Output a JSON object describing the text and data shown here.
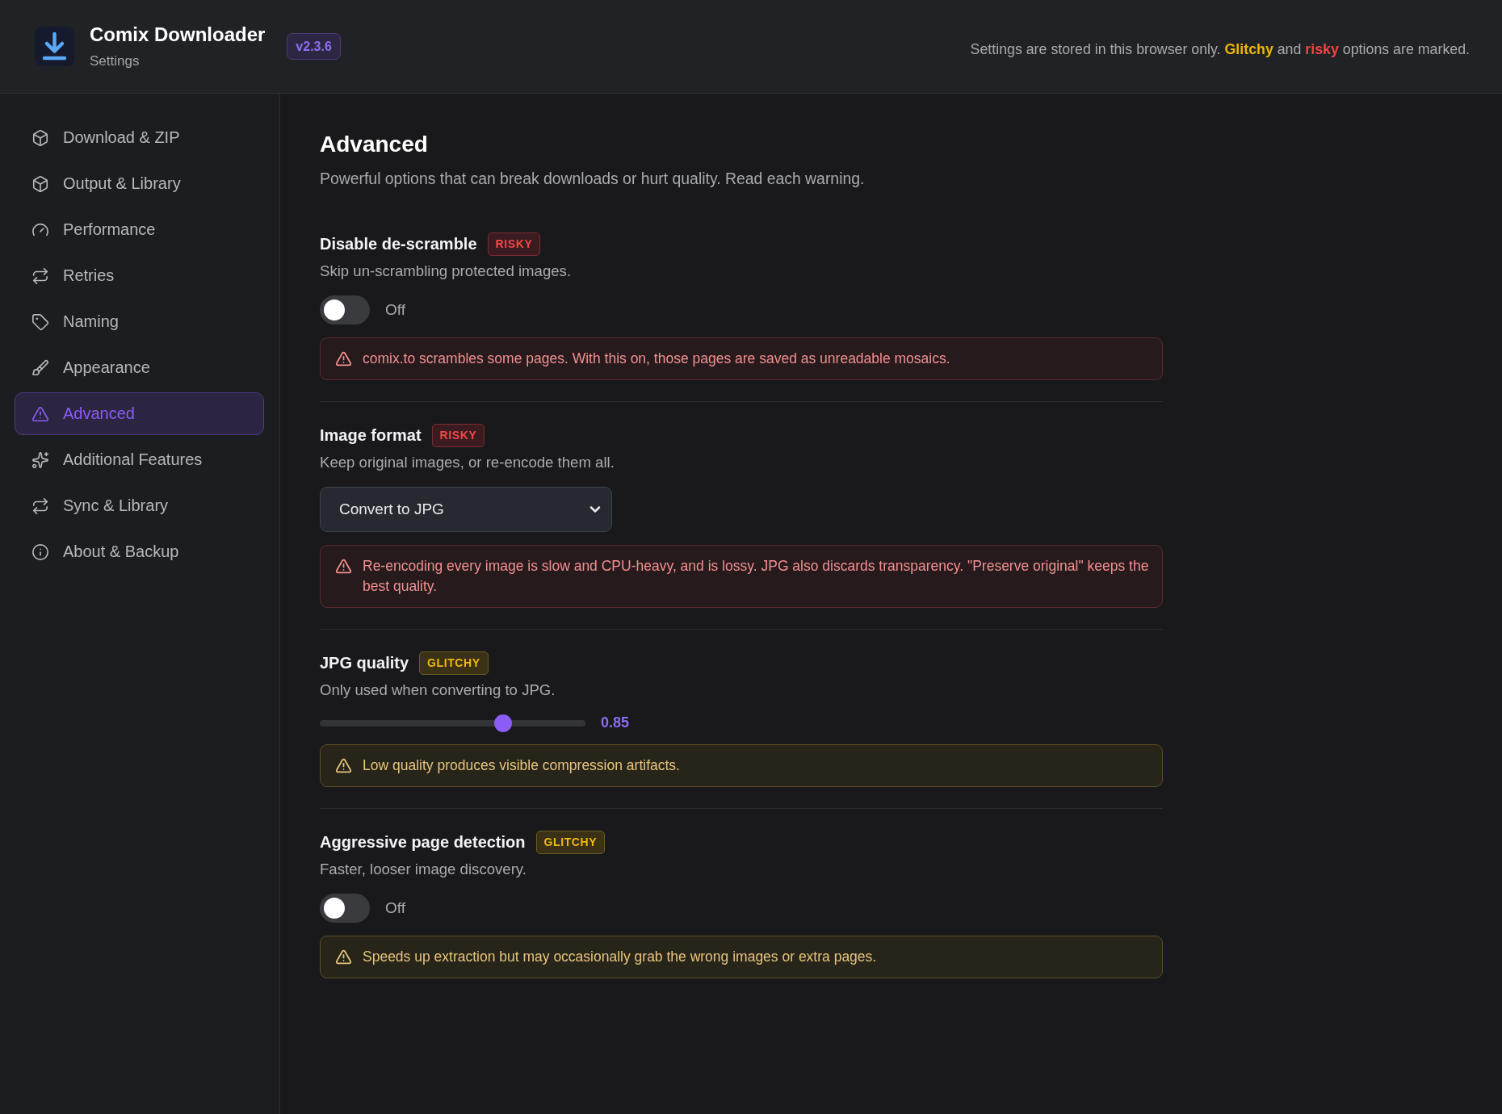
{
  "header": {
    "title": "Comix Downloader",
    "subtitle": "Settings",
    "version": "v2.3.6",
    "notice": [
      {
        "text": "Settings are stored in this browser only.",
        "kind": "plain"
      },
      {
        "text": "Glitchy",
        "kind": "glitchy"
      },
      {
        "text": "and",
        "kind": "plain"
      },
      {
        "text": "risky",
        "kind": "risky"
      },
      {
        "text": "options are marked.",
        "kind": "plain"
      }
    ]
  },
  "sidebar": {
    "items": [
      {
        "label": "Download & ZIP",
        "selected": false
      },
      {
        "label": "Output & Library",
        "selected": false
      },
      {
        "label": "Performance",
        "selected": false
      },
      {
        "label": "Retries",
        "selected": false
      },
      {
        "label": "Naming",
        "selected": false
      },
      {
        "label": "Appearance",
        "selected": false
      },
      {
        "label": "Advanced",
        "selected": true
      },
      {
        "label": "Additional Features",
        "selected": false
      },
      {
        "label": "Sync & Library",
        "selected": false
      },
      {
        "label": "About & Backup",
        "selected": false
      }
    ]
  },
  "page": {
    "title": "Advanced",
    "description": "Powerful options that can break downloads or hurt quality. Read each warning."
  },
  "settings": [
    {
      "kind": "toggle",
      "label": "Disable de-scramble",
      "badge": {
        "text": "RISKY",
        "kind": "risky"
      },
      "description": "Skip un-scrambling protected images.",
      "on": false,
      "state_label": "Off",
      "warning": "comix.to scrambles some pages. With this on, those pages are saved as unreadable mosaics."
    },
    {
      "kind": "select",
      "label": "Image format",
      "badge": {
        "text": "RISKY",
        "kind": "risky"
      },
      "description": "Keep original images, or re-encode them all.",
      "value": "Convert to JPG",
      "warning": "Re-encoding every image is slow and CPU-heavy, and is lossy. JPG also discards transparency. \"Preserve original\" keeps the best quality."
    },
    {
      "kind": "slider",
      "label": "JPG quality",
      "badge": {
        "text": "GLITCHY",
        "kind": "glitchy"
      },
      "description": "Only used when converting to JPG.",
      "level": 0.69,
      "reading": "0.85",
      "warning": "Low quality produces visible compression artifacts."
    },
    {
      "kind": "toggle",
      "label": "Aggressive page detection",
      "badge": {
        "text": "GLITCHY",
        "kind": "glitchy"
      },
      "description": "Faster, looser image discovery.",
      "on": false,
      "state_label": "Off",
      "warning": "Speeds up extraction but may occasionally grab the wrong images or extra pages."
    }
  ]
}
